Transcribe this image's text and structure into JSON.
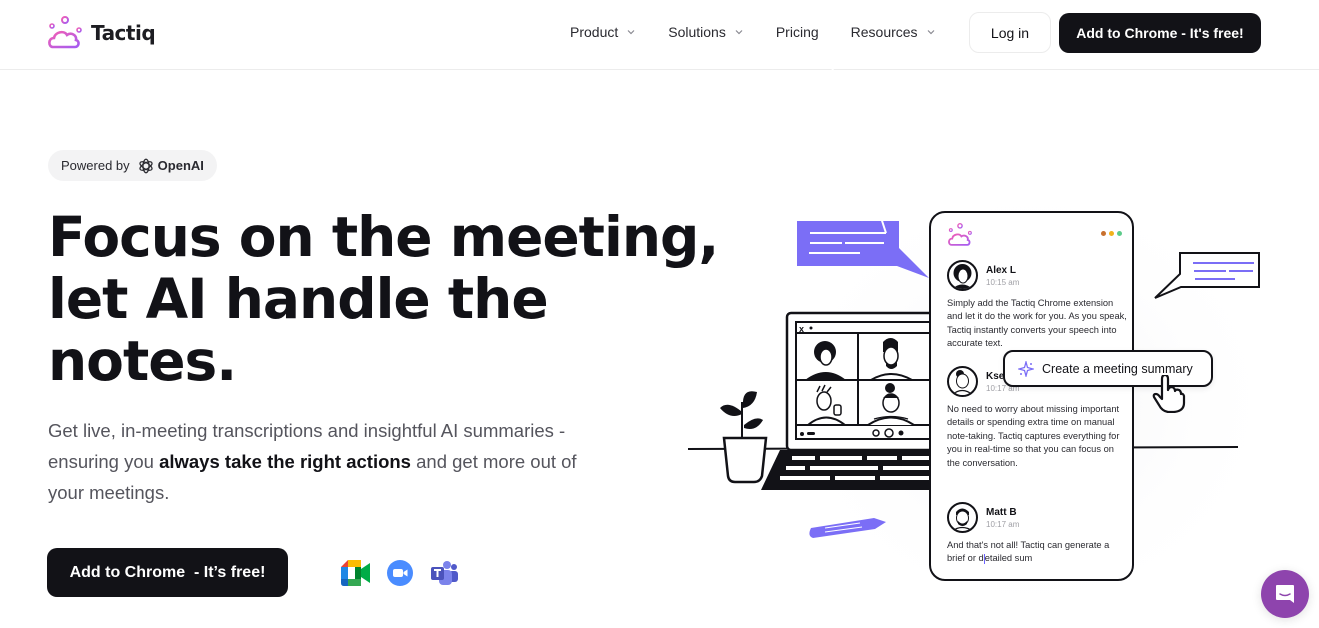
{
  "header": {
    "brand": "Tactiq",
    "nav": [
      {
        "label": "Product",
        "has_dropdown": true
      },
      {
        "label": "Solutions",
        "has_dropdown": true
      },
      {
        "label": "Pricing",
        "has_dropdown": false
      },
      {
        "label": "Resources",
        "has_dropdown": true
      }
    ],
    "login_label": "Log in",
    "cta_label": "Add to Chrome - It's free!"
  },
  "hero": {
    "badge_prefix": "Powered by",
    "badge_brand": "OpenAI",
    "headline_lines": [
      "Focus on the meeting,",
      "let AI handle the",
      "notes."
    ],
    "subtext_before": "Get live, in-meeting transcriptions and insightful AI summaries - ensuring you ",
    "subtext_bold": "always take the right actions",
    "subtext_after": " and get more out of your meetings.",
    "cta_label": "Add to Chrome  - It’s free!",
    "integrations": [
      {
        "name": "Google Meet",
        "icon": "google-meet-icon"
      },
      {
        "name": "Zoom",
        "icon": "zoom-icon"
      },
      {
        "name": "Microsoft Teams",
        "icon": "teams-icon"
      }
    ]
  },
  "illustration": {
    "window_dots": [
      "#c8702e",
      "#f2b21b",
      "#5ccb8a"
    ],
    "accent": "#7b6ef6",
    "messages": [
      {
        "name": "Alex L",
        "time": "10:15 am",
        "body": "Simply add the Tactiq Chrome extension and let it do the work for you. As you speak, Tactiq instantly converts your speech into accurate text."
      },
      {
        "name": "Ksenia",
        "time": "10:17 am",
        "body": "No need to worry about missing important details or spending extra time on manual note-taking. Tactiq captures everything for you in real-time so that you can focus on the conversation."
      },
      {
        "name": "Matt B",
        "time": "10:17 am",
        "body_before": "And that's not all! Tactiq can generate a brief or d",
        "body_after": "etailed sum"
      }
    ],
    "summary_button": "Create a meeting summary"
  },
  "chat_widget": {
    "color": "#8e44ad",
    "icon": "chat-icon"
  }
}
